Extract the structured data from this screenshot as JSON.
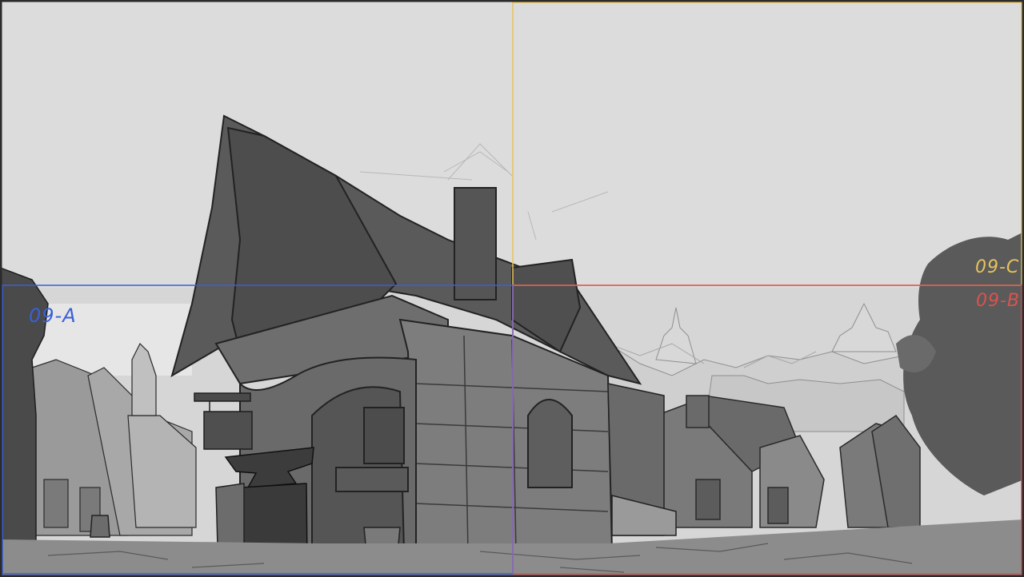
{
  "frames": {
    "a": {
      "label": "09-A",
      "color": "#3a5fd9"
    },
    "b": {
      "label": "09-B",
      "color": "#d9534f"
    },
    "c": {
      "label": "09-C",
      "color": "#e6c35c"
    }
  },
  "palette": {
    "sky": "#dcdcdc",
    "sky_lower": "#d2d2d2",
    "building_dark": "#5a5a5a",
    "building_mid": "#6e6e6e",
    "building_light": "#9a9a9a",
    "ink": "#2a2a2a",
    "ground": "#8c8c8c",
    "border": "#2b2b2b",
    "purple_guide": "#8a6fb0"
  }
}
